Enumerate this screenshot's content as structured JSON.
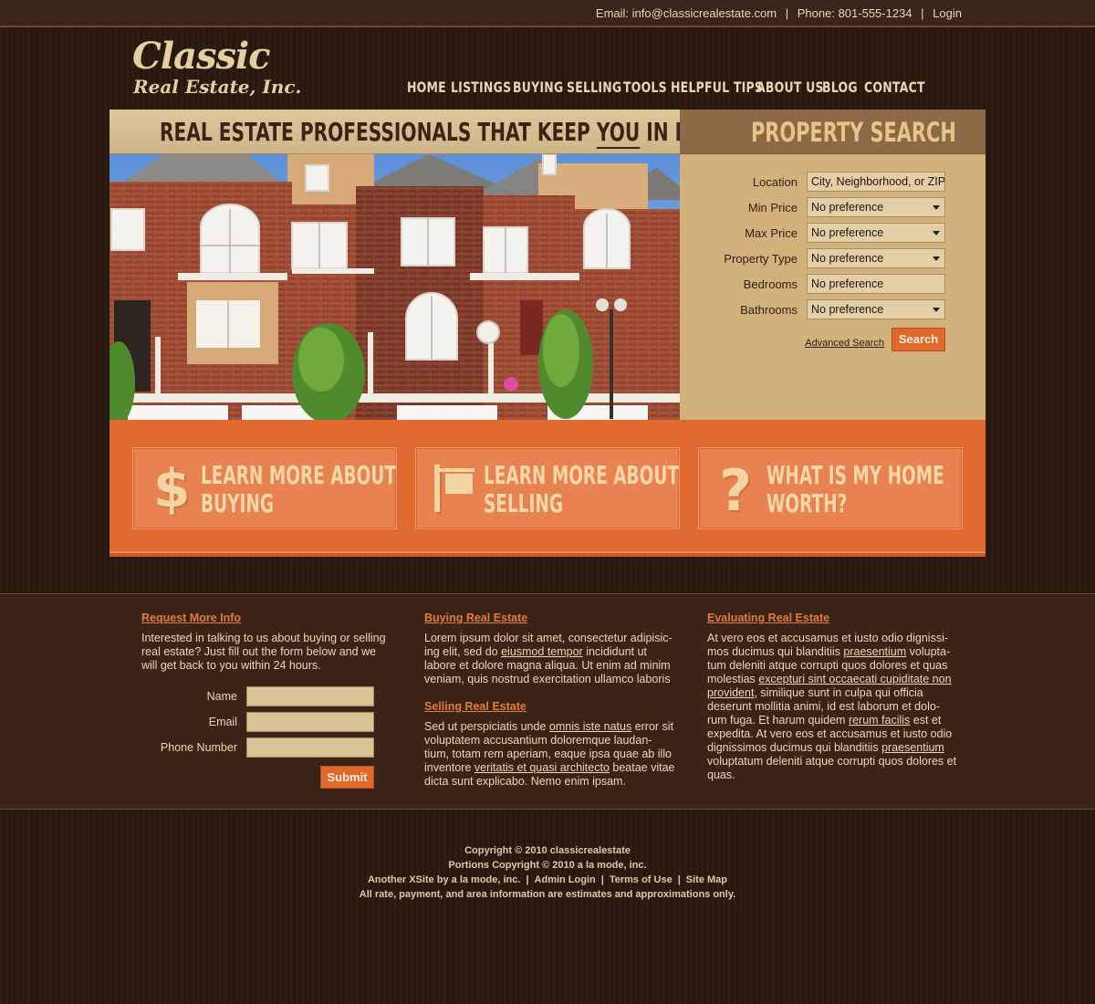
{
  "topbar": {
    "email_label": "Email:",
    "email": "info@classicrealestate.com",
    "phone_label": "Phone:",
    "phone": "801-555-1234",
    "login": "Login"
  },
  "logo": {
    "line1": "Classic",
    "line2": "Real Estate, Inc."
  },
  "nav": [
    "HOME",
    "LISTINGS",
    "BUYING",
    "SELLING",
    "TOOLS",
    "HELPFUL TIPS",
    "ABOUT US",
    "BLOG",
    "CONTACT"
  ],
  "hero": {
    "banner_pre": "REAL ESTATE PROFESSIONALS THAT KEEP ",
    "banner_you": "YOU",
    "banner_post": " IN MIND"
  },
  "search": {
    "title": "PROPERTY SEARCH",
    "fields": [
      {
        "label": "Location",
        "value": "City, Neighborhood, or ZIP",
        "type": "text"
      },
      {
        "label": "Min Price",
        "value": "No preference",
        "type": "select"
      },
      {
        "label": "Max Price",
        "value": "No preference",
        "type": "select"
      },
      {
        "label": "Property Type",
        "value": "No preference",
        "type": "select"
      },
      {
        "label": "Bedrooms",
        "value": "No preference",
        "type": "text"
      },
      {
        "label": "Bathrooms",
        "value": "No preference",
        "type": "select"
      }
    ],
    "advanced_link": "Advanced Search",
    "button": "Search"
  },
  "cta": [
    {
      "line1": "LEARN MORE ABOUT",
      "line2": "BUYING",
      "icon": "dollar-icon"
    },
    {
      "line1": "LEARN MORE ABOUT",
      "line2": "SELLING",
      "icon": "sign-icon"
    },
    {
      "line1": "WHAT IS MY HOME",
      "line2": "WORTH?",
      "icon": "question-icon"
    }
  ],
  "info": {
    "request": {
      "title": "Request More Info",
      "intro": "Interested in talking to us about buying or selling real estate? Just fill out the form below and we will get back to you within 24 hours.",
      "name_label": "Name",
      "email_label": "Email",
      "phone_label": "Phone Number",
      "submit": "Submit"
    },
    "buying": {
      "title": "Buying Real Estate",
      "text_a": "Lorem ipsum dolor sit amet, consectetur adipisic-ing elit, sed do ",
      "link": "eiusmod tempor",
      "text_b": " incididunt ut labore et dolore magna aliqua. Ut enim ad minim veniam, quis nostrud exercitation ullamco laboris"
    },
    "selling": {
      "title": "Selling Real Estate",
      "text_a": "Sed ut perspiciatis unde ",
      "link1": "omnis iste natus",
      "text_b": " error sit voluptatem accusantium doloremque laudan-tium, totam rem aperiam, eaque ipsa quae ab illo inventore ",
      "link2": "veritatis et quasi architecto",
      "text_c": " beatae vitae dicta sunt explicabo. Nemo enim ipsam."
    },
    "evaluating": {
      "title": "Evaluating Real Estate",
      "text_a": "At vero eos et accusamus et iusto odio dignissi-mos ducimus qui blanditiis ",
      "link1": "praesentium",
      "text_b": " volupta-tum deleniti atque corrupti quos dolores et quas molestias ",
      "link2": "excepturi sint occaecati cupiditate non provident",
      "text_c": ", similique sunt in culpa qui officia deserunt mollitia animi, id est laborum et dolo-rum fuga. Et harum quidem ",
      "link3": "rerum facilis",
      "text_d": " est et expedita. At vero eos et accusamus et iusto odio dignissimos ducimus qui blanditiis ",
      "link4": "praesentium",
      "text_e": " voluptatum deleniti atque corrupti quos dolores et quas."
    }
  },
  "footer": {
    "line1": "Copyright © 2010 classicrealestate",
    "line2": "Portions Copyright © 2010 a la mode, inc.",
    "link1": "Another XSite by a la mode, inc.",
    "link2": "Admin Login",
    "link3": "Terms of Use",
    "link4": "Site Map",
    "line4": "All rate, payment, and area information are estimates and approximations only."
  },
  "colors": {
    "background": "#2d1c12",
    "accent_orange": "#e06a30",
    "tan": "#d2b17b",
    "heading_orange": "#e57a3a"
  }
}
